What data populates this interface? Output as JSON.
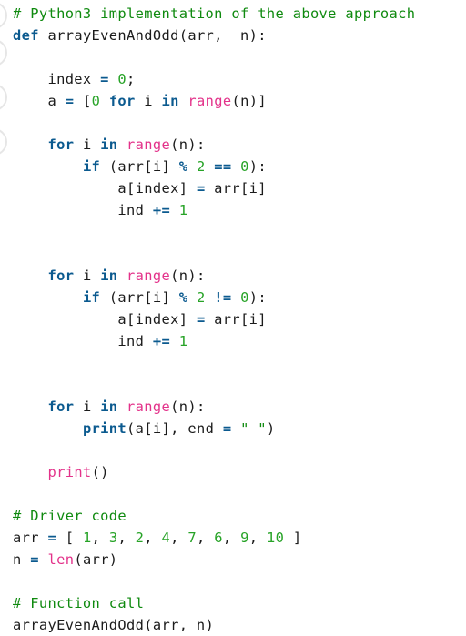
{
  "colors": {
    "comment": "#0f8a0f",
    "keyword": "#0b5a8f",
    "builtin": "#e3328a",
    "number": "#27a327",
    "text": "#1b1b1b",
    "background": "#ffffff"
  },
  "code": {
    "language": "Python3",
    "lines": [
      [
        {
          "t": "c",
          "v": "# Python3 implementation of the above approach"
        }
      ],
      [
        {
          "t": "k",
          "v": "def"
        },
        {
          "t": "t",
          "v": " arrayEvenAndOdd(arr,  n):"
        }
      ],
      [],
      [
        {
          "t": "t",
          "v": "    index "
        },
        {
          "t": "op",
          "v": "="
        },
        {
          "t": "t",
          "v": " "
        },
        {
          "t": "nm",
          "v": "0"
        },
        {
          "t": "t",
          "v": ";"
        }
      ],
      [
        {
          "t": "t",
          "v": "    a "
        },
        {
          "t": "op",
          "v": "="
        },
        {
          "t": "t",
          "v": " ["
        },
        {
          "t": "nm",
          "v": "0"
        },
        {
          "t": "t",
          "v": " "
        },
        {
          "t": "k",
          "v": "for"
        },
        {
          "t": "t",
          "v": " i "
        },
        {
          "t": "k",
          "v": "in"
        },
        {
          "t": "t",
          "v": " "
        },
        {
          "t": "b",
          "v": "range"
        },
        {
          "t": "t",
          "v": "(n)]"
        }
      ],
      [],
      [
        {
          "t": "t",
          "v": "    "
        },
        {
          "t": "k",
          "v": "for"
        },
        {
          "t": "t",
          "v": " i "
        },
        {
          "t": "k",
          "v": "in"
        },
        {
          "t": "t",
          "v": " "
        },
        {
          "t": "b",
          "v": "range"
        },
        {
          "t": "t",
          "v": "(n):"
        }
      ],
      [
        {
          "t": "t",
          "v": "        "
        },
        {
          "t": "k",
          "v": "if"
        },
        {
          "t": "t",
          "v": " (arr[i] "
        },
        {
          "t": "op",
          "v": "%"
        },
        {
          "t": "t",
          "v": " "
        },
        {
          "t": "nm",
          "v": "2"
        },
        {
          "t": "t",
          "v": " "
        },
        {
          "t": "op",
          "v": "=="
        },
        {
          "t": "t",
          "v": " "
        },
        {
          "t": "nm",
          "v": "0"
        },
        {
          "t": "t",
          "v": "):"
        }
      ],
      [
        {
          "t": "t",
          "v": "            a[index] "
        },
        {
          "t": "op",
          "v": "="
        },
        {
          "t": "t",
          "v": " arr[i]"
        }
      ],
      [
        {
          "t": "t",
          "v": "            ind "
        },
        {
          "t": "op",
          "v": "+="
        },
        {
          "t": "t",
          "v": " "
        },
        {
          "t": "nm",
          "v": "1"
        }
      ],
      [],
      [],
      [
        {
          "t": "t",
          "v": "    "
        },
        {
          "t": "k",
          "v": "for"
        },
        {
          "t": "t",
          "v": " i "
        },
        {
          "t": "k",
          "v": "in"
        },
        {
          "t": "t",
          "v": " "
        },
        {
          "t": "b",
          "v": "range"
        },
        {
          "t": "t",
          "v": "(n):"
        }
      ],
      [
        {
          "t": "t",
          "v": "        "
        },
        {
          "t": "k",
          "v": "if"
        },
        {
          "t": "t",
          "v": " (arr[i] "
        },
        {
          "t": "op",
          "v": "%"
        },
        {
          "t": "t",
          "v": " "
        },
        {
          "t": "nm",
          "v": "2"
        },
        {
          "t": "t",
          "v": " "
        },
        {
          "t": "op",
          "v": "!="
        },
        {
          "t": "t",
          "v": " "
        },
        {
          "t": "nm",
          "v": "0"
        },
        {
          "t": "t",
          "v": "):"
        }
      ],
      [
        {
          "t": "t",
          "v": "            a[index] "
        },
        {
          "t": "op",
          "v": "="
        },
        {
          "t": "t",
          "v": " arr[i]"
        }
      ],
      [
        {
          "t": "t",
          "v": "            ind "
        },
        {
          "t": "op",
          "v": "+="
        },
        {
          "t": "t",
          "v": " "
        },
        {
          "t": "nm",
          "v": "1"
        }
      ],
      [],
      [],
      [
        {
          "t": "t",
          "v": "    "
        },
        {
          "t": "k",
          "v": "for"
        },
        {
          "t": "t",
          "v": " i "
        },
        {
          "t": "k",
          "v": "in"
        },
        {
          "t": "t",
          "v": " "
        },
        {
          "t": "b",
          "v": "range"
        },
        {
          "t": "t",
          "v": "(n):"
        }
      ],
      [
        {
          "t": "t",
          "v": "        "
        },
        {
          "t": "k",
          "v": "print"
        },
        {
          "t": "t",
          "v": "(a[i], end "
        },
        {
          "t": "op",
          "v": "="
        },
        {
          "t": "t",
          "v": " "
        },
        {
          "t": "s",
          "v": "\" \""
        },
        {
          "t": "t",
          "v": ")"
        }
      ],
      [],
      [
        {
          "t": "t",
          "v": "    "
        },
        {
          "t": "b",
          "v": "print"
        },
        {
          "t": "t",
          "v": "()"
        }
      ],
      [],
      [
        {
          "t": "c",
          "v": "# Driver code"
        }
      ],
      [
        {
          "t": "t",
          "v": "arr "
        },
        {
          "t": "op",
          "v": "="
        },
        {
          "t": "t",
          "v": " [ "
        },
        {
          "t": "nm",
          "v": "1"
        },
        {
          "t": "t",
          "v": ", "
        },
        {
          "t": "nm",
          "v": "3"
        },
        {
          "t": "t",
          "v": ", "
        },
        {
          "t": "nm",
          "v": "2"
        },
        {
          "t": "t",
          "v": ", "
        },
        {
          "t": "nm",
          "v": "4"
        },
        {
          "t": "t",
          "v": ", "
        },
        {
          "t": "nm",
          "v": "7"
        },
        {
          "t": "t",
          "v": ", "
        },
        {
          "t": "nm",
          "v": "6"
        },
        {
          "t": "t",
          "v": ", "
        },
        {
          "t": "nm",
          "v": "9"
        },
        {
          "t": "t",
          "v": ", "
        },
        {
          "t": "nm",
          "v": "10"
        },
        {
          "t": "t",
          "v": " ]"
        }
      ],
      [
        {
          "t": "t",
          "v": "n "
        },
        {
          "t": "op",
          "v": "="
        },
        {
          "t": "t",
          "v": " "
        },
        {
          "t": "b",
          "v": "len"
        },
        {
          "t": "t",
          "v": "(arr)"
        }
      ],
      [],
      [
        {
          "t": "c",
          "v": "# Function call"
        }
      ],
      [
        {
          "t": "t",
          "v": "arrayEvenAndOdd(arr, n)"
        }
      ]
    ]
  }
}
